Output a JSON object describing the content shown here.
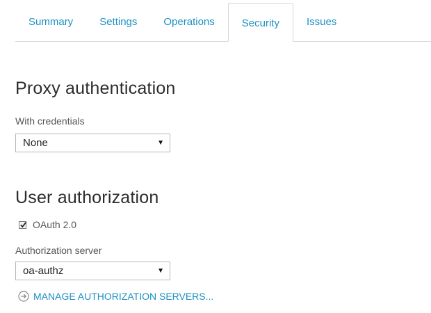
{
  "tabs": [
    {
      "label": "Summary",
      "active": false
    },
    {
      "label": "Settings",
      "active": false
    },
    {
      "label": "Operations",
      "active": false
    },
    {
      "label": "Security",
      "active": true
    },
    {
      "label": "Issues",
      "active": false
    }
  ],
  "proxy_auth": {
    "title": "Proxy authentication",
    "credentials_label": "With credentials",
    "credentials_value": "None"
  },
  "user_auth": {
    "title": "User authorization",
    "oauth_label": "OAuth 2.0",
    "oauth_checked": true,
    "server_label": "Authorization server",
    "server_value": "oa-authz",
    "manage_link": "MANAGE AUTHORIZATION SERVERS..."
  },
  "colors": {
    "accent": "#1d90c4",
    "border": "#d4d4d4",
    "title_text": "#2c2c2c",
    "label_text": "#555555"
  },
  "icons": {
    "select_arrow": "triangle-down",
    "manage_link": "arrow-right-circle",
    "checkbox": "checkmark"
  }
}
